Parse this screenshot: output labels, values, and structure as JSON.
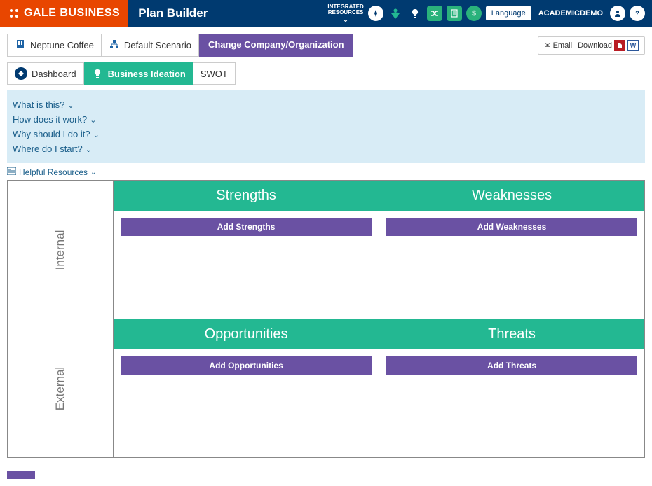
{
  "header": {
    "brand": "GALE BUSINESS",
    "app_title": "Plan Builder",
    "integrated_label": "INTEGRATED\nRESOURCES",
    "language_label": "Language",
    "user_name": "ACADEMICDEMO"
  },
  "toolbar": {
    "crumb1": "Neptune Coffee",
    "crumb2": "Default Scenario",
    "change_btn": "Change Company/Organization",
    "email_label": "Email",
    "download_label": "Download"
  },
  "tabs": {
    "dashboard": "Dashboard",
    "ideation": "Business Ideation",
    "swot": "SWOT"
  },
  "faq": {
    "q1": "What is this?",
    "q2": "How does it work?",
    "q3": "Why should I do it?",
    "q4": "Where do I start?"
  },
  "helpful": "Helpful Resources",
  "swot_grid": {
    "axis_internal": "Internal",
    "axis_external": "External",
    "strengths": {
      "title": "Strengths",
      "add": "Add Strengths"
    },
    "weaknesses": {
      "title": "Weaknesses",
      "add": "Add Weaknesses"
    },
    "opportunities": {
      "title": "Opportunities",
      "add": "Add Opportunities"
    },
    "threats": {
      "title": "Threats",
      "add": "Add Threats"
    }
  }
}
